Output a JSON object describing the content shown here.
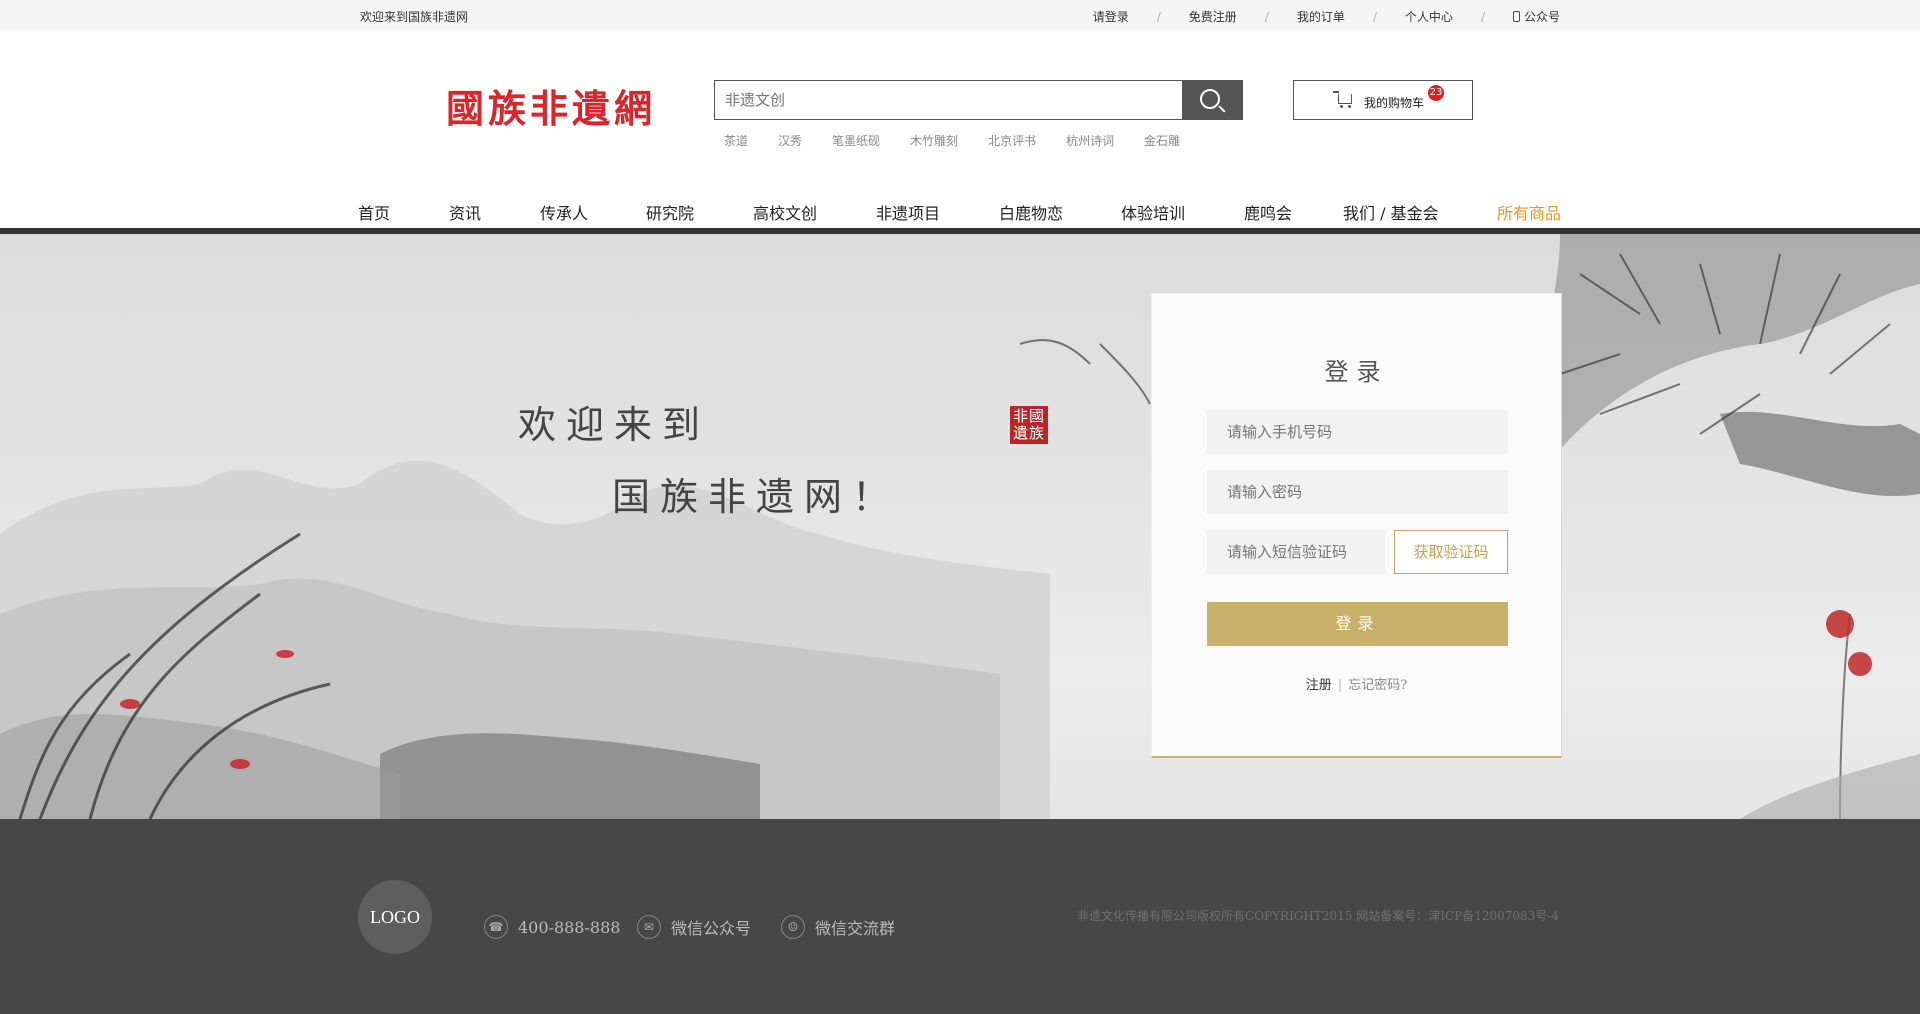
{
  "topbar": {
    "welcome": "欢迎来到国族非遗网",
    "links": [
      "请登录",
      "免费注册",
      "我的订单",
      "个人中心",
      "公众号"
    ],
    "separator": "/"
  },
  "header": {
    "logo_text": "國族非遺網",
    "search_placeholder": "非遗文创",
    "hot_keywords": [
      "茶道",
      "汉秀",
      "笔墨纸砚",
      "木竹雕刻",
      "北京评书",
      "杭州诗词",
      "金石雕"
    ],
    "cart_label": "我的购物车",
    "cart_count": "23"
  },
  "nav": {
    "items": [
      "首页",
      "资讯",
      "传承人",
      "研究院",
      "高校文创",
      "非遗项目",
      "白鹿物恋",
      "体验培训",
      "鹿鸣会",
      "我们 / 基金会",
      "所有商品"
    ],
    "active_color": "#e39a1c"
  },
  "hero": {
    "line1": "欢迎来到",
    "line2": "国族非遗网！",
    "seal_text": "非國遺族"
  },
  "login": {
    "title": "登录",
    "phone_placeholder": "请输入手机号码",
    "password_placeholder": "请输入密码",
    "sms_placeholder": "请输入短信验证码",
    "sms_button": "获取验证码",
    "submit": "登录",
    "register": "注册",
    "divider": "|",
    "forgot": "忘记密码?",
    "accent_color": "#c8b06a"
  },
  "footer": {
    "logo": "LOGO",
    "phone": "400-888-888",
    "wechat_official": "微信公众号",
    "wechat_group": "微信交流群",
    "copyright": "非遗文化传播有限公司版权所有COPYRIGHT2015  网站备案号：津ICP备12007083号-4"
  }
}
